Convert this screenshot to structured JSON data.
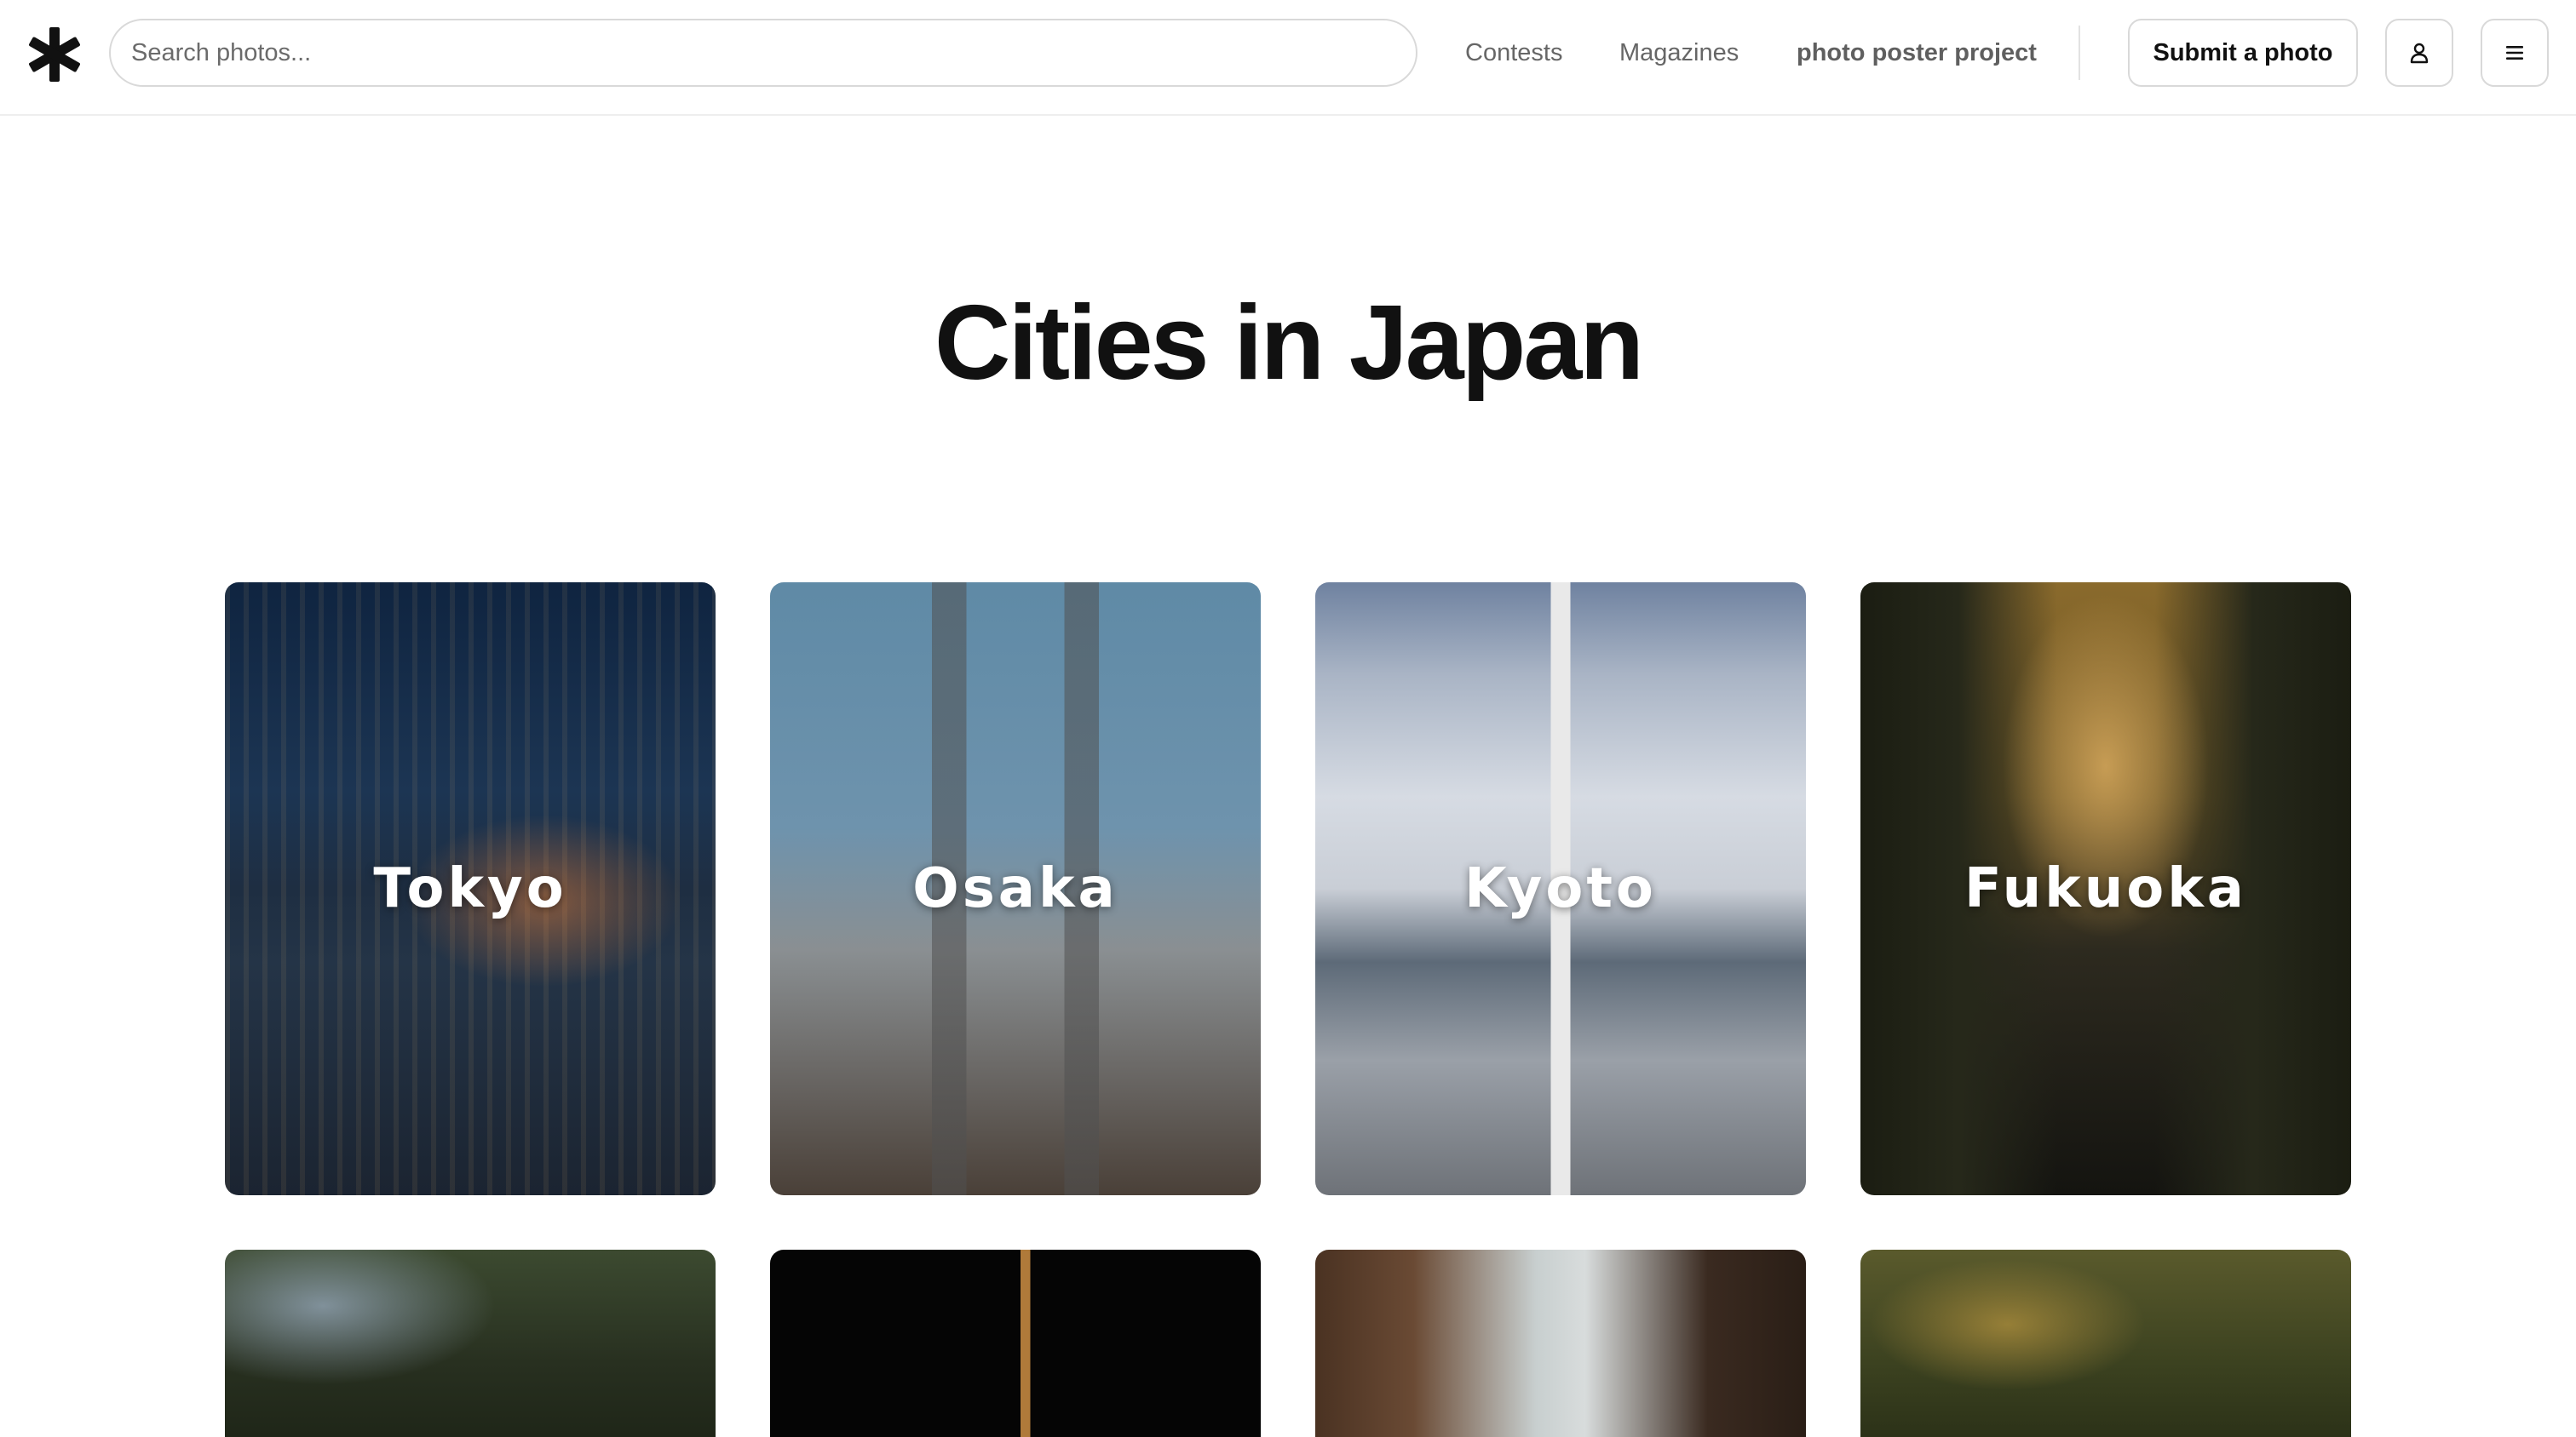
{
  "header": {
    "search_placeholder": "Search photos...",
    "nav": {
      "contests": "Contests",
      "magazines": "Magazines",
      "photo_poster_project": "photo poster project"
    },
    "submit_label": "Submit a photo",
    "icons": {
      "logo": "asterisk-logo-icon",
      "user": "user-icon",
      "menu": "hamburger-menu-icon"
    }
  },
  "page": {
    "title": "Cities in Japan"
  },
  "cities": [
    {
      "name": "Tokyo"
    },
    {
      "name": "Osaka"
    },
    {
      "name": "Kyoto"
    },
    {
      "name": "Fukuoka"
    }
  ],
  "colors": {
    "text": "#111111",
    "nav_text": "#666666",
    "border": "#d9d9d9",
    "label": "#ffffff"
  }
}
